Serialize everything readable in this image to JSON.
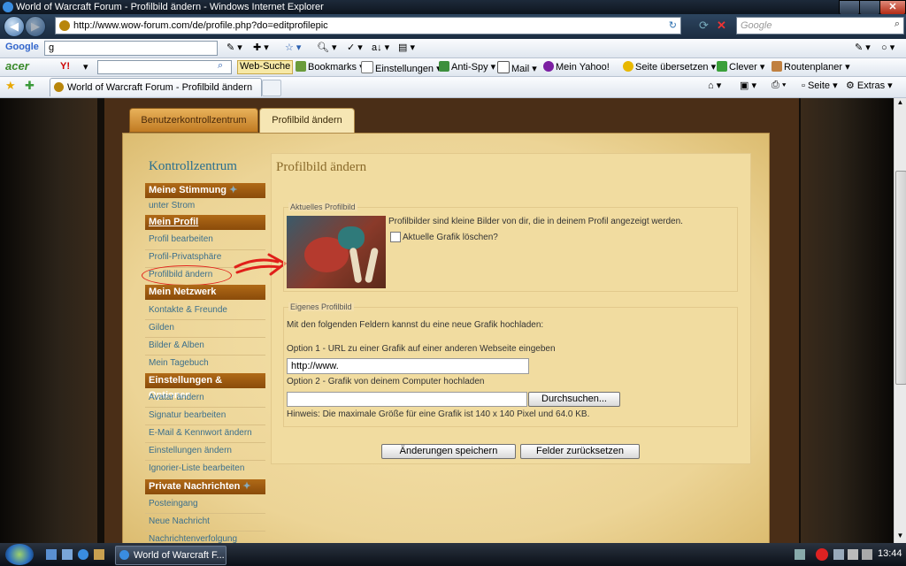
{
  "window": {
    "title": "World of Warcraft Forum - Profilbild ändern - Windows Internet Explorer"
  },
  "address": {
    "url": "http://www.wow-forum.com/de/profile.php?do=editprofilepic",
    "search_placeholder": "Google"
  },
  "google_toolbar": {
    "logo": "Google",
    "search_text": "g"
  },
  "acer_toolbar": {
    "logo": "acer",
    "yahoo": "Y!",
    "web_search": "Web-Suche",
    "items": [
      "Bookmarks",
      "Einstellungen",
      "Anti-Spy",
      "Mail",
      "Mein Yahoo!",
      "Seite übersetzen",
      "Clever",
      "Routenplaner"
    ]
  },
  "tab_bar": {
    "active_tab": "World of Warcraft Forum - Profilbild ändern",
    "page_menu": "Seite",
    "extras_menu": "Extras"
  },
  "page": {
    "tabs": [
      "Benutzerkontrollzentrum",
      "Profilbild ändern"
    ],
    "sidebar": {
      "title": "Kontrollzentrum",
      "sections": [
        {
          "header": "Meine Stimmung",
          "links": [
            "unter Strom"
          ]
        },
        {
          "header": "Mein Profil",
          "links": [
            "Profil bearbeiten",
            "Profil-Privatsphäre",
            "Profilbild ändern"
          ]
        },
        {
          "header": "Mein Netzwerk",
          "links": [
            "Kontakte & Freunde",
            "Gilden",
            "Bilder & Alben",
            "Mein Tagebuch"
          ]
        },
        {
          "header": "Einstellungen & Optionen",
          "links": [
            "Avatar ändern",
            "Signatur bearbeiten",
            "E-Mail & Kennwort ändern",
            "Einstellungen ändern",
            "Ignorier-Liste bearbeiten"
          ]
        },
        {
          "header": "Private Nachrichten",
          "links": [
            "Posteingang",
            "Neue Nachricht",
            "Nachrichtenverfolgung"
          ]
        }
      ]
    },
    "main": {
      "title": "Profilbild ändern",
      "current": {
        "legend": "Aktuelles Profilbild",
        "description": "Profilbilder sind kleine Bilder von dir, die in deinem Profil angezeigt werden.",
        "delete_label": "Aktuelle Grafik löschen?"
      },
      "own": {
        "legend": "Eigenes Profilbild",
        "intro": "Mit den folgenden Feldern kannst du eine neue Grafik hochladen:",
        "option1": "Option 1 - URL zu einer Grafik auf einer anderen Webseite eingeben",
        "url_value": "http://www.",
        "option2": "Option 2 - Grafik von deinem Computer hochladen",
        "browse": "Durchsuchen...",
        "hint": "Hinweis: Die maximale Größe für eine Grafik ist 140 x 140 Pixel und 64.0 KB."
      },
      "save_button": "Änderungen speichern",
      "reset_button": "Felder zurücksetzen"
    }
  },
  "taskbar": {
    "task": "World of Warcraft F...",
    "clock": "13:44"
  },
  "colors": {
    "accent_orange": "#a35f12",
    "link_blue": "#3b6f8c",
    "annotation_red": "#e0201a"
  }
}
